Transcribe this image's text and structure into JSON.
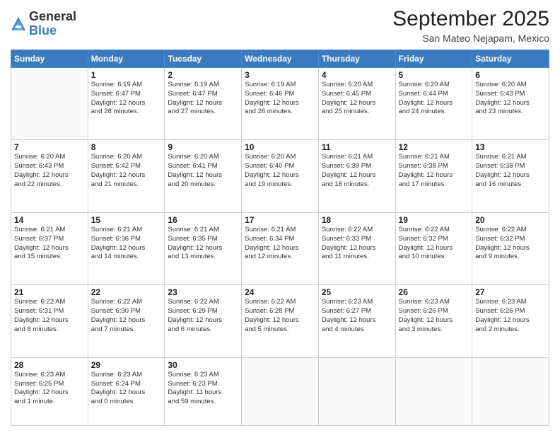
{
  "logo": {
    "general": "General",
    "blue": "Blue"
  },
  "header": {
    "month": "September 2025",
    "location": "San Mateo Nejapam, Mexico"
  },
  "weekdays": [
    "Sunday",
    "Monday",
    "Tuesday",
    "Wednesday",
    "Thursday",
    "Friday",
    "Saturday"
  ],
  "weeks": [
    [
      {
        "day": "",
        "info": ""
      },
      {
        "day": "1",
        "info": "Sunrise: 6:19 AM\nSunset: 6:47 PM\nDaylight: 12 hours\nand 28 minutes."
      },
      {
        "day": "2",
        "info": "Sunrise: 6:19 AM\nSunset: 6:47 PM\nDaylight: 12 hours\nand 27 minutes."
      },
      {
        "day": "3",
        "info": "Sunrise: 6:19 AM\nSunset: 6:46 PM\nDaylight: 12 hours\nand 26 minutes."
      },
      {
        "day": "4",
        "info": "Sunrise: 6:20 AM\nSunset: 6:45 PM\nDaylight: 12 hours\nand 25 minutes."
      },
      {
        "day": "5",
        "info": "Sunrise: 6:20 AM\nSunset: 6:44 PM\nDaylight: 12 hours\nand 24 minutes."
      },
      {
        "day": "6",
        "info": "Sunrise: 6:20 AM\nSunset: 6:43 PM\nDaylight: 12 hours\nand 23 minutes."
      }
    ],
    [
      {
        "day": "7",
        "info": "Sunrise: 6:20 AM\nSunset: 6:43 PM\nDaylight: 12 hours\nand 22 minutes."
      },
      {
        "day": "8",
        "info": "Sunrise: 6:20 AM\nSunset: 6:42 PM\nDaylight: 12 hours\nand 21 minutes."
      },
      {
        "day": "9",
        "info": "Sunrise: 6:20 AM\nSunset: 6:41 PM\nDaylight: 12 hours\nand 20 minutes."
      },
      {
        "day": "10",
        "info": "Sunrise: 6:20 AM\nSunset: 6:40 PM\nDaylight: 12 hours\nand 19 minutes."
      },
      {
        "day": "11",
        "info": "Sunrise: 6:21 AM\nSunset: 6:39 PM\nDaylight: 12 hours\nand 18 minutes."
      },
      {
        "day": "12",
        "info": "Sunrise: 6:21 AM\nSunset: 6:38 PM\nDaylight: 12 hours\nand 17 minutes."
      },
      {
        "day": "13",
        "info": "Sunrise: 6:21 AM\nSunset: 6:38 PM\nDaylight: 12 hours\nand 16 minutes."
      }
    ],
    [
      {
        "day": "14",
        "info": "Sunrise: 6:21 AM\nSunset: 6:37 PM\nDaylight: 12 hours\nand 15 minutes."
      },
      {
        "day": "15",
        "info": "Sunrise: 6:21 AM\nSunset: 6:36 PM\nDaylight: 12 hours\nand 14 minutes."
      },
      {
        "day": "16",
        "info": "Sunrise: 6:21 AM\nSunset: 6:35 PM\nDaylight: 12 hours\nand 13 minutes."
      },
      {
        "day": "17",
        "info": "Sunrise: 6:21 AM\nSunset: 6:34 PM\nDaylight: 12 hours\nand 12 minutes."
      },
      {
        "day": "18",
        "info": "Sunrise: 6:22 AM\nSunset: 6:33 PM\nDaylight: 12 hours\nand 11 minutes."
      },
      {
        "day": "19",
        "info": "Sunrise: 6:22 AM\nSunset: 6:32 PM\nDaylight: 12 hours\nand 10 minutes."
      },
      {
        "day": "20",
        "info": "Sunrise: 6:22 AM\nSunset: 6:32 PM\nDaylight: 12 hours\nand 9 minutes."
      }
    ],
    [
      {
        "day": "21",
        "info": "Sunrise: 6:22 AM\nSunset: 6:31 PM\nDaylight: 12 hours\nand 8 minutes."
      },
      {
        "day": "22",
        "info": "Sunrise: 6:22 AM\nSunset: 6:30 PM\nDaylight: 12 hours\nand 7 minutes."
      },
      {
        "day": "23",
        "info": "Sunrise: 6:22 AM\nSunset: 6:29 PM\nDaylight: 12 hours\nand 6 minutes."
      },
      {
        "day": "24",
        "info": "Sunrise: 6:22 AM\nSunset: 6:28 PM\nDaylight: 12 hours\nand 5 minutes."
      },
      {
        "day": "25",
        "info": "Sunrise: 6:23 AM\nSunset: 6:27 PM\nDaylight: 12 hours\nand 4 minutes."
      },
      {
        "day": "26",
        "info": "Sunrise: 6:23 AM\nSunset: 6:26 PM\nDaylight: 12 hours\nand 3 minutes."
      },
      {
        "day": "27",
        "info": "Sunrise: 6:23 AM\nSunset: 6:26 PM\nDaylight: 12 hours\nand 2 minutes."
      }
    ],
    [
      {
        "day": "28",
        "info": "Sunrise: 6:23 AM\nSunset: 6:25 PM\nDaylight: 12 hours\nand 1 minute."
      },
      {
        "day": "29",
        "info": "Sunrise: 6:23 AM\nSunset: 6:24 PM\nDaylight: 12 hours\nand 0 minutes."
      },
      {
        "day": "30",
        "info": "Sunrise: 6:23 AM\nSunset: 6:23 PM\nDaylight: 11 hours\nand 59 minutes."
      },
      {
        "day": "",
        "info": ""
      },
      {
        "day": "",
        "info": ""
      },
      {
        "day": "",
        "info": ""
      },
      {
        "day": "",
        "info": ""
      }
    ]
  ]
}
